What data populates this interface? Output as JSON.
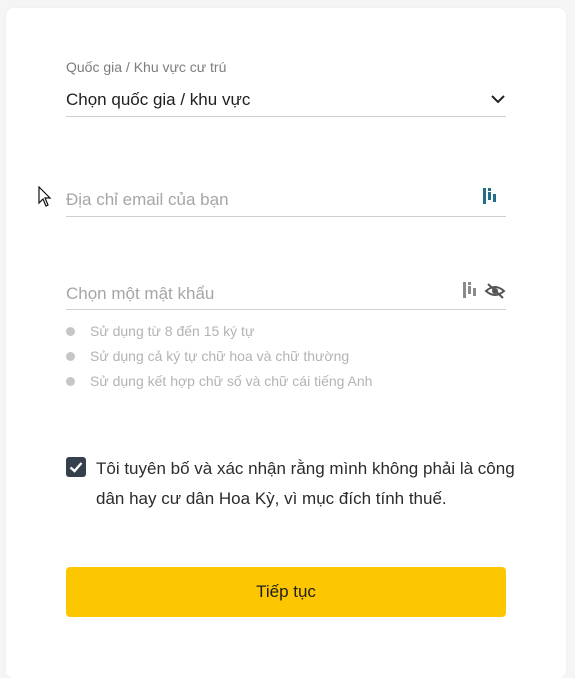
{
  "form": {
    "country": {
      "label": "Quốc gia / Khu vực cư trú",
      "value": "Chọn quốc gia / khu vực"
    },
    "email": {
      "placeholder": "Địa chỉ email của bạn"
    },
    "password": {
      "placeholder": "Chọn một mật khẩu",
      "rules": [
        "Sử dụng từ 8 đến 15 ký tự",
        "Sử dụng cả ký tự chữ hoa và chữ thường",
        "Sử dụng kết hợp chữ số và chữ cái tiếng Anh"
      ]
    },
    "declaration": {
      "checked": true,
      "text": "Tôi tuyên bố và xác nhận rằng mình không phải là công dân hay cư dân Hoa Kỳ, vì mục đích tính thuế."
    },
    "submit_label": "Tiếp tục"
  },
  "icons": {
    "chevron": "chevron-down-icon",
    "keyboard": "password-manager-icon",
    "eye": "eye-slash-icon",
    "check": "checkmark-icon"
  },
  "colors": {
    "accent": "#fcc700",
    "checkbox": "#36404d",
    "keyboard_icon_email": "#1f6f86"
  }
}
